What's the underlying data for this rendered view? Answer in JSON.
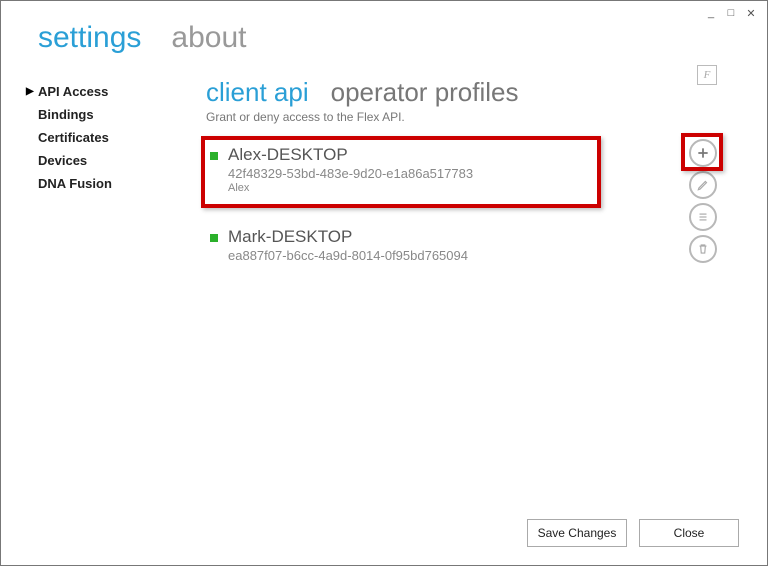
{
  "window": {
    "tabs": {
      "settings": "settings",
      "about": "about"
    },
    "controls": {
      "min": "_",
      "max": "□",
      "close": "✕"
    }
  },
  "sidebar": {
    "items": [
      {
        "label": "API Access",
        "active": true
      },
      {
        "label": "Bindings"
      },
      {
        "label": "Certificates"
      },
      {
        "label": "Devices"
      },
      {
        "label": "DNA Fusion"
      }
    ]
  },
  "content": {
    "title_accent": "client api",
    "title_muted": "operator profiles",
    "subtitle": "Grant or deny access to the Flex API.",
    "f_badge": "F",
    "items": [
      {
        "name": "Alex-DESKTOP",
        "guid": "42f48329-53bd-483e-9d20-e1a86a517783",
        "user": "Alex"
      },
      {
        "name": "Mark-DESKTOP",
        "guid": "ea887f07-b6cc-4a9d-8014-0f95bd765094"
      }
    ]
  },
  "footer": {
    "save": "Save Changes",
    "close": "Close"
  }
}
